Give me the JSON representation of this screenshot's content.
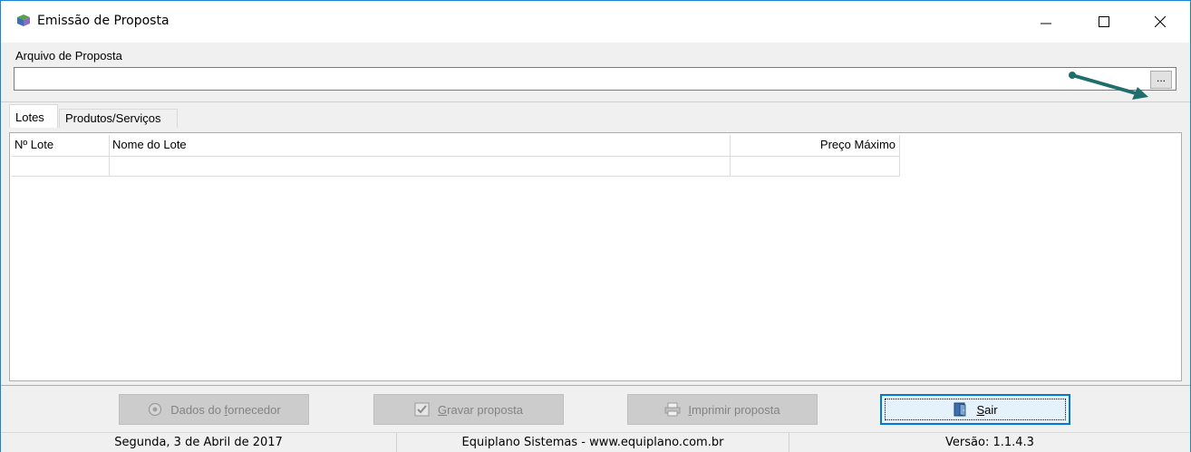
{
  "window": {
    "title": "Emissão de Proposta",
    "accent_color": "#1883d7"
  },
  "file_section": {
    "label": "Arquivo de Proposta",
    "value": "",
    "browse_label": "..."
  },
  "tabs": [
    {
      "label": "Lotes",
      "active": true
    },
    {
      "label": "Produtos/Serviços",
      "active": false
    }
  ],
  "grid": {
    "columns": [
      "Nº Lote",
      "Nome do Lote",
      "Preço Máximo"
    ],
    "rows": [
      [
        "",
        "",
        ""
      ]
    ]
  },
  "buttons": {
    "dados": {
      "label_pre": "Dados do ",
      "label_ul": "f",
      "label_post": "ornecedor",
      "icon": "gear-icon",
      "enabled": false
    },
    "gravar": {
      "label_pre": "",
      "label_ul": "G",
      "label_post": "ravar proposta",
      "icon": "check-icon",
      "enabled": false
    },
    "imprimir": {
      "label_pre": "",
      "label_ul": "I",
      "label_post": "mprimir proposta",
      "icon": "printer-icon",
      "enabled": false
    },
    "sair": {
      "label_pre": "",
      "label_ul": "S",
      "label_post": "air",
      "icon": "exit-door-icon",
      "enabled": true
    }
  },
  "statusbar": {
    "date": "Segunda, 3 de Abril de 2017",
    "company": "Equiplano Sistemas - www.equiplano.com.br",
    "version": "Versão: 1.1.4.3"
  },
  "annotation": {
    "arrow_color": "#1f6e6e"
  }
}
